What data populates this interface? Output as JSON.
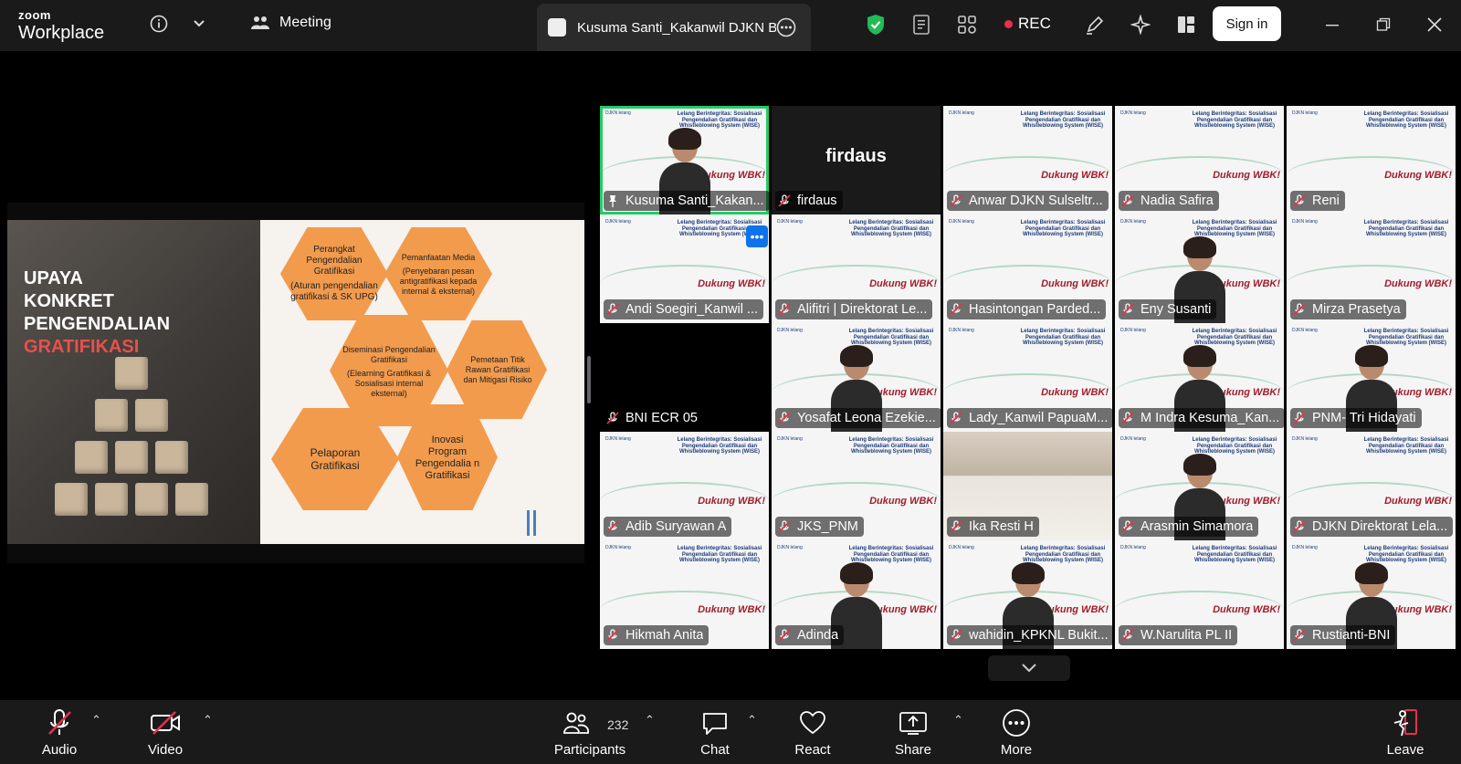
{
  "app": {
    "logo_line1": "zoom",
    "logo_line2": "Workplace"
  },
  "topbar": {
    "meeting_label": "Meeting",
    "active_tab": "Kusuma Santi_Kakanwil DJKN Ban",
    "rec_label": "REC",
    "signin_label": "Sign in"
  },
  "slide": {
    "title_lines": [
      "UPAYA",
      "KONKRET",
      "PENGENDALIAN"
    ],
    "title_highlight": "GRATIFIKASI",
    "hex": [
      {
        "title": "Perangkat Pengendalian Gratifikasi",
        "sub": "(Aturan pengendalian gratifikasi & SK UPG)"
      },
      {
        "title": "Pemanfaatan Media",
        "sub": "(Penyebaran pesan antigratifikasi kepada internal & eksternal)"
      },
      {
        "title": "Diseminasi Pengendalian Gratifikasi",
        "sub": "(Elearning Gratifikasi & Sosialisasi internal eksternal)"
      },
      {
        "title": "Pemetaan Titik Rawan Gratifikasi dan Mitigasi Risiko",
        "sub": ""
      },
      {
        "title": "Pelaporan Gratifikasi",
        "sub": ""
      },
      {
        "title": "Inovasi Program Pengendalia n Gratifikasi",
        "sub": ""
      }
    ]
  },
  "tile_banner": {
    "logos": "DJKN lelang",
    "title": "Lelang Berintegritas: Sosialisasi Pengendalian Gratifikasi dan Whistleblowing System (WISE)",
    "stamp": "Dukung WBK!"
  },
  "participants": [
    {
      "name": "Kusuma Santi_Kakan...",
      "style": "person-banner",
      "pinned": true
    },
    {
      "name": "firdaus",
      "style": "dark-name"
    },
    {
      "name": "Anwar DJKN Sulseltr...",
      "style": "banner"
    },
    {
      "name": "Nadia Safira",
      "style": "banner"
    },
    {
      "name": "Reni",
      "style": "banner"
    },
    {
      "name": "Andi Soegiri_Kanwil ...",
      "style": "banner"
    },
    {
      "name": "Alifitri | Direktorat Le...",
      "style": "banner"
    },
    {
      "name": "Hasintongan Parded...",
      "style": "banner"
    },
    {
      "name": "Eny Susanti",
      "style": "person-banner"
    },
    {
      "name": "Mirza Prasetya",
      "style": "banner"
    },
    {
      "name": "BNI ECR 05",
      "style": "black"
    },
    {
      "name": "Yosafat Leona Ezekie...",
      "style": "person-banner"
    },
    {
      "name": "Lady_Kanwil PapuaM...",
      "style": "banner"
    },
    {
      "name": "M Indra Kesuma_Kan...",
      "style": "person-banner"
    },
    {
      "name": "PNM- Tri Hidayati",
      "style": "person-banner"
    },
    {
      "name": "Adib Suryawan A",
      "style": "banner"
    },
    {
      "name": "JKS_PNM",
      "style": "banner"
    },
    {
      "name": "Ika Resti H",
      "style": "room"
    },
    {
      "name": "Arasmin Simamora",
      "style": "person-banner"
    },
    {
      "name": "DJKN Direktorat Lela...",
      "style": "banner"
    },
    {
      "name": "Hikmah Anita",
      "style": "banner"
    },
    {
      "name": "Adinda",
      "style": "person-banner"
    },
    {
      "name": "wahidin_KPKNL Bukit...",
      "style": "person-banner"
    },
    {
      "name": "W.Narulita PL II",
      "style": "banner"
    },
    {
      "name": "Rustianti-BNI",
      "style": "person-banner"
    }
  ],
  "bottombar": {
    "audio": "Audio",
    "video": "Video",
    "participants": "Participants",
    "participant_count": "232",
    "chat": "Chat",
    "react": "React",
    "share": "Share",
    "more": "More",
    "leave": "Leave"
  },
  "colors": {
    "accent_blue": "#0e72ed",
    "rec_red": "#e8304a",
    "active_green": "#22cc66",
    "hex_orange": "#f29b4d",
    "shield_green": "#22bb55"
  }
}
